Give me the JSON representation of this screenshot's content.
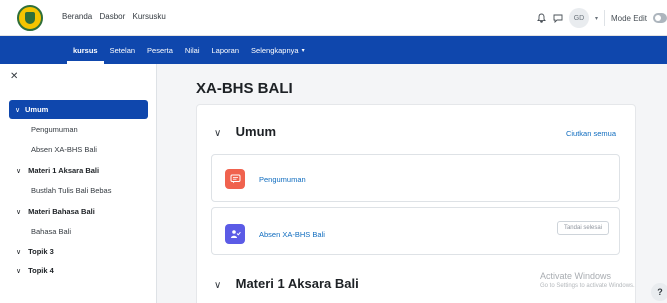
{
  "topbar": {
    "nav": [
      "Beranda",
      "Dasbor",
      "Kursusku"
    ],
    "avatar_initials": "GD",
    "mode_edit_label": "Mode Edit"
  },
  "subnav": {
    "items": [
      "kursus",
      "Setelan",
      "Peserta",
      "Nilai",
      "Laporan",
      "Selengkapnya"
    ]
  },
  "drawer": {
    "items": [
      {
        "label": "Umum"
      },
      {
        "label": "Pengumuman"
      },
      {
        "label": "Absen XA-BHS Bali"
      },
      {
        "label": "Materi 1 Aksara Bali"
      },
      {
        "label": "Bustlah Tulis Bali Bebas"
      },
      {
        "label": "Materi Bahasa Bali"
      },
      {
        "label": "Bahasa Bali"
      },
      {
        "label": "Topik 3"
      },
      {
        "label": "Topik 4"
      }
    ]
  },
  "main": {
    "course_title": "XA-BHS BALI",
    "collapse_all": "Ciutkan semua",
    "sections": [
      {
        "title": "Umum"
      },
      {
        "title": "Materi 1 Aksara Bali"
      }
    ],
    "activities": [
      {
        "name": "Pengumuman",
        "color": "#f0624e"
      },
      {
        "name": "Absen XA-BHS Bali",
        "color": "#5b5be6",
        "completion": "Tandai selesai"
      }
    ]
  },
  "watermark": {
    "title": "Activate Windows",
    "subtitle": "Go to Settings to activate Windows."
  },
  "help_label": "?"
}
